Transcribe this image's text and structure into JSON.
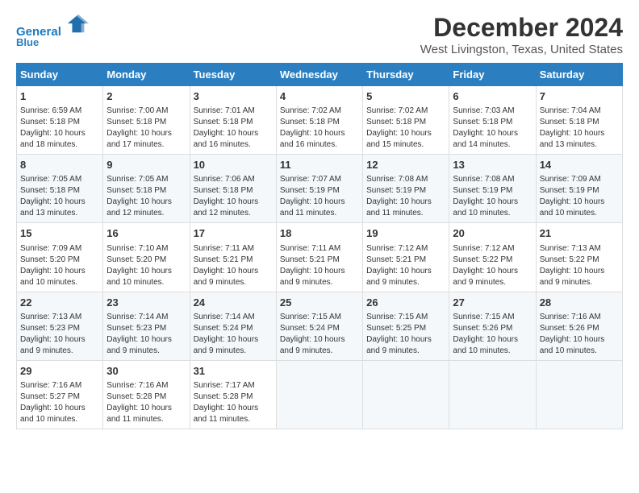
{
  "header": {
    "logo_line1": "General",
    "logo_line2": "Blue",
    "title": "December 2024",
    "subtitle": "West Livingston, Texas, United States"
  },
  "calendar": {
    "days_of_week": [
      "Sunday",
      "Monday",
      "Tuesday",
      "Wednesday",
      "Thursday",
      "Friday",
      "Saturday"
    ],
    "weeks": [
      [
        null,
        null,
        null,
        null,
        null,
        null,
        null
      ],
      [
        null,
        null,
        null,
        null,
        null,
        null,
        null
      ],
      [
        null,
        null,
        null,
        null,
        null,
        null,
        null
      ],
      [
        null,
        null,
        null,
        null,
        null,
        null,
        null
      ],
      [
        null,
        null,
        null,
        null,
        null,
        null,
        null
      ]
    ],
    "cells": [
      {
        "day": 1,
        "col": 0,
        "row": 0,
        "sunrise": "6:59 AM",
        "sunset": "5:18 PM",
        "daylight": "10 hours and 18 minutes."
      },
      {
        "day": 2,
        "col": 1,
        "row": 0,
        "sunrise": "7:00 AM",
        "sunset": "5:18 PM",
        "daylight": "10 hours and 17 minutes."
      },
      {
        "day": 3,
        "col": 2,
        "row": 0,
        "sunrise": "7:01 AM",
        "sunset": "5:18 PM",
        "daylight": "10 hours and 16 minutes."
      },
      {
        "day": 4,
        "col": 3,
        "row": 0,
        "sunrise": "7:02 AM",
        "sunset": "5:18 PM",
        "daylight": "10 hours and 16 minutes."
      },
      {
        "day": 5,
        "col": 4,
        "row": 0,
        "sunrise": "7:02 AM",
        "sunset": "5:18 PM",
        "daylight": "10 hours and 15 minutes."
      },
      {
        "day": 6,
        "col": 5,
        "row": 0,
        "sunrise": "7:03 AM",
        "sunset": "5:18 PM",
        "daylight": "10 hours and 14 minutes."
      },
      {
        "day": 7,
        "col": 6,
        "row": 0,
        "sunrise": "7:04 AM",
        "sunset": "5:18 PM",
        "daylight": "10 hours and 13 minutes."
      },
      {
        "day": 8,
        "col": 0,
        "row": 1,
        "sunrise": "7:05 AM",
        "sunset": "5:18 PM",
        "daylight": "10 hours and 13 minutes."
      },
      {
        "day": 9,
        "col": 1,
        "row": 1,
        "sunrise": "7:05 AM",
        "sunset": "5:18 PM",
        "daylight": "10 hours and 12 minutes."
      },
      {
        "day": 10,
        "col": 2,
        "row": 1,
        "sunrise": "7:06 AM",
        "sunset": "5:18 PM",
        "daylight": "10 hours and 12 minutes."
      },
      {
        "day": 11,
        "col": 3,
        "row": 1,
        "sunrise": "7:07 AM",
        "sunset": "5:19 PM",
        "daylight": "10 hours and 11 minutes."
      },
      {
        "day": 12,
        "col": 4,
        "row": 1,
        "sunrise": "7:08 AM",
        "sunset": "5:19 PM",
        "daylight": "10 hours and 11 minutes."
      },
      {
        "day": 13,
        "col": 5,
        "row": 1,
        "sunrise": "7:08 AM",
        "sunset": "5:19 PM",
        "daylight": "10 hours and 10 minutes."
      },
      {
        "day": 14,
        "col": 6,
        "row": 1,
        "sunrise": "7:09 AM",
        "sunset": "5:19 PM",
        "daylight": "10 hours and 10 minutes."
      },
      {
        "day": 15,
        "col": 0,
        "row": 2,
        "sunrise": "7:09 AM",
        "sunset": "5:20 PM",
        "daylight": "10 hours and 10 minutes."
      },
      {
        "day": 16,
        "col": 1,
        "row": 2,
        "sunrise": "7:10 AM",
        "sunset": "5:20 PM",
        "daylight": "10 hours and 10 minutes."
      },
      {
        "day": 17,
        "col": 2,
        "row": 2,
        "sunrise": "7:11 AM",
        "sunset": "5:21 PM",
        "daylight": "10 hours and 9 minutes."
      },
      {
        "day": 18,
        "col": 3,
        "row": 2,
        "sunrise": "7:11 AM",
        "sunset": "5:21 PM",
        "daylight": "10 hours and 9 minutes."
      },
      {
        "day": 19,
        "col": 4,
        "row": 2,
        "sunrise": "7:12 AM",
        "sunset": "5:21 PM",
        "daylight": "10 hours and 9 minutes."
      },
      {
        "day": 20,
        "col": 5,
        "row": 2,
        "sunrise": "7:12 AM",
        "sunset": "5:22 PM",
        "daylight": "10 hours and 9 minutes."
      },
      {
        "day": 21,
        "col": 6,
        "row": 2,
        "sunrise": "7:13 AM",
        "sunset": "5:22 PM",
        "daylight": "10 hours and 9 minutes."
      },
      {
        "day": 22,
        "col": 0,
        "row": 3,
        "sunrise": "7:13 AM",
        "sunset": "5:23 PM",
        "daylight": "10 hours and 9 minutes."
      },
      {
        "day": 23,
        "col": 1,
        "row": 3,
        "sunrise": "7:14 AM",
        "sunset": "5:23 PM",
        "daylight": "10 hours and 9 minutes."
      },
      {
        "day": 24,
        "col": 2,
        "row": 3,
        "sunrise": "7:14 AM",
        "sunset": "5:24 PM",
        "daylight": "10 hours and 9 minutes."
      },
      {
        "day": 25,
        "col": 3,
        "row": 3,
        "sunrise": "7:15 AM",
        "sunset": "5:24 PM",
        "daylight": "10 hours and 9 minutes."
      },
      {
        "day": 26,
        "col": 4,
        "row": 3,
        "sunrise": "7:15 AM",
        "sunset": "5:25 PM",
        "daylight": "10 hours and 9 minutes."
      },
      {
        "day": 27,
        "col": 5,
        "row": 3,
        "sunrise": "7:15 AM",
        "sunset": "5:26 PM",
        "daylight": "10 hours and 10 minutes."
      },
      {
        "day": 28,
        "col": 6,
        "row": 3,
        "sunrise": "7:16 AM",
        "sunset": "5:26 PM",
        "daylight": "10 hours and 10 minutes."
      },
      {
        "day": 29,
        "col": 0,
        "row": 4,
        "sunrise": "7:16 AM",
        "sunset": "5:27 PM",
        "daylight": "10 hours and 10 minutes."
      },
      {
        "day": 30,
        "col": 1,
        "row": 4,
        "sunrise": "7:16 AM",
        "sunset": "5:28 PM",
        "daylight": "10 hours and 11 minutes."
      },
      {
        "day": 31,
        "col": 2,
        "row": 4,
        "sunrise": "7:17 AM",
        "sunset": "5:28 PM",
        "daylight": "10 hours and 11 minutes."
      }
    ]
  }
}
